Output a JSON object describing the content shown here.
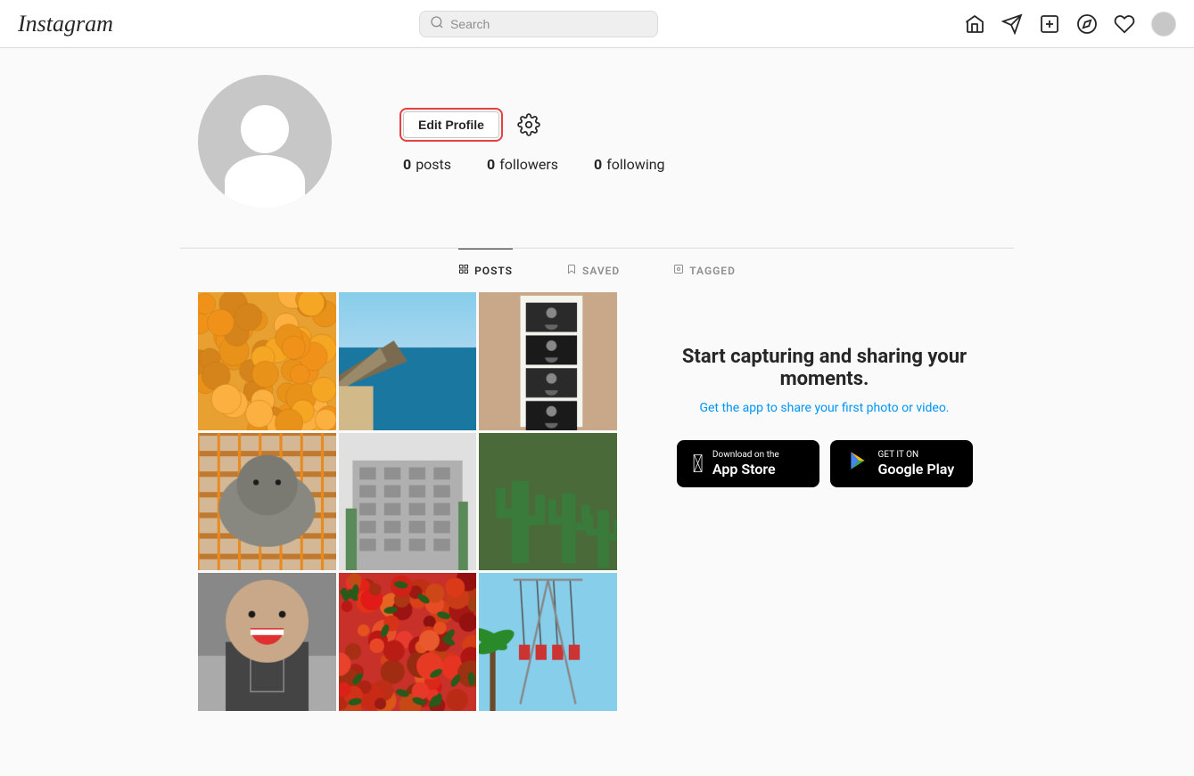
{
  "header": {
    "logo": "Instagram",
    "search_placeholder": "Search",
    "nav_icons": [
      "home",
      "direct",
      "new-post",
      "explore",
      "activity"
    ],
    "avatar_alt": "User avatar"
  },
  "profile": {
    "username": "",
    "edit_button_label": "Edit Profile",
    "stats": {
      "posts_count": "0",
      "posts_label": "posts",
      "followers_count": "0",
      "followers_label": "followers",
      "following_count": "0",
      "following_label": "following"
    }
  },
  "tabs": [
    {
      "id": "posts",
      "label": "POSTS",
      "active": true
    },
    {
      "id": "saved",
      "label": "SAVED",
      "active": false
    },
    {
      "id": "tagged",
      "label": "TAGGED",
      "active": false
    }
  ],
  "cta": {
    "title": "Start capturing and sharing your moments.",
    "subtitle": "Get the app to share your first photo or video.",
    "app_store_sub": "Download on the",
    "app_store_name": "App Store",
    "google_play_sub": "GET IT ON",
    "google_play_name": "Google Play"
  }
}
